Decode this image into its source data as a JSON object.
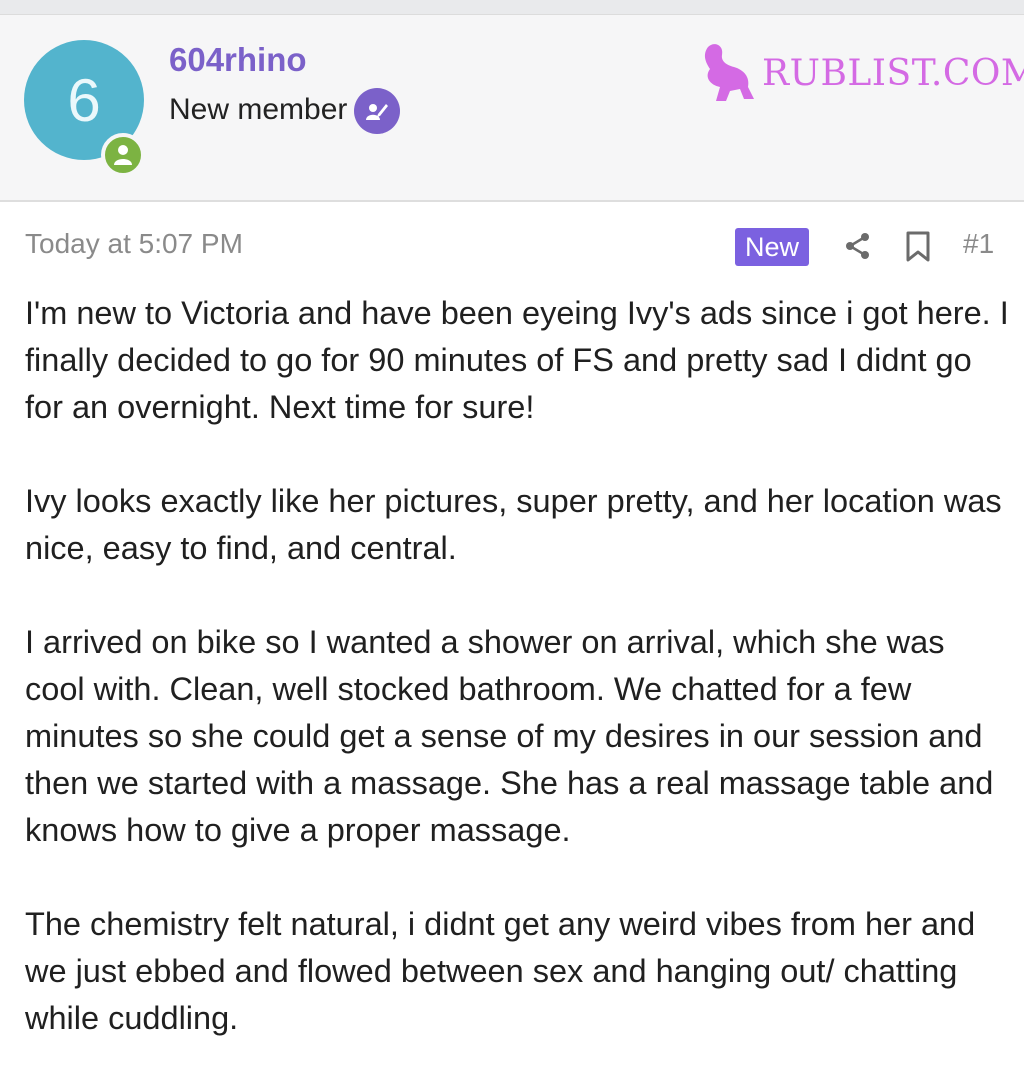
{
  "user": {
    "avatar_letter": "6",
    "username": "604rhino",
    "title": "New member",
    "avatar_color": "#53b4cd",
    "online_color": "#7cb342",
    "accent_color": "#7b61c9"
  },
  "logo": {
    "text": "RUBLIST.COM",
    "color": "#d46ae4"
  },
  "post": {
    "timestamp": "Today at 5:07 PM",
    "new_label": "New",
    "number": "#1",
    "icons": [
      "share-icon",
      "bookmark-icon"
    ],
    "paragraphs": [
      "I'm new to Victoria and have been eyeing Ivy's ads since i got here. I finally decided to go for 90 minutes of FS and pretty sad I didnt go for an overnight. Next time for sure!",
      "Ivy looks exactly like her pictures, super pretty, and her location was nice, easy to find, and central.",
      "I arrived on bike so I wanted a shower on arrival, which she was cool with. Clean, well stocked bathroom. We chatted for a few minutes so she could get a sense of my desires in our session and then we started with a massage. She has a real massage table and knows how to give a proper massage.",
      "The chemistry felt natural, i didnt get any weird vibes from her and we just ebbed and flowed between sex and hanging out/ chatting while cuddling."
    ]
  }
}
